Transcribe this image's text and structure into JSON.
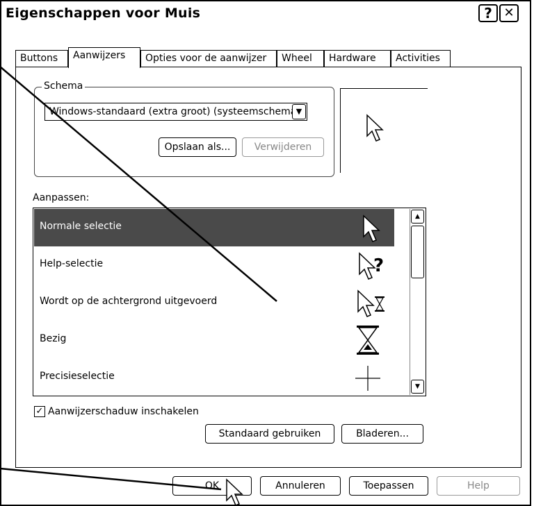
{
  "window": {
    "title": "Eigenschappen voor Muis",
    "help_glyph": "?",
    "close_glyph": "✕"
  },
  "tabs": [
    {
      "label": "Buttons"
    },
    {
      "label": "Aanwijzers"
    },
    {
      "label": "Opties voor de aanwijzer"
    },
    {
      "label": "Wheel"
    },
    {
      "label": "Hardware"
    },
    {
      "label": "Activities"
    }
  ],
  "active_tab": "Aanwijzers",
  "schema": {
    "group_label": "Schema",
    "selected": "Windows-standaard (extra groot) (systeemschema)",
    "save_as_label": "Opslaan als...",
    "delete_label": "Verwijderen"
  },
  "customize": {
    "label": "Aanpassen:",
    "items": [
      {
        "label": "Normale selectie",
        "icon": "arrow-pointer-icon",
        "selected": true
      },
      {
        "label": "Help-selectie",
        "icon": "help-pointer-icon",
        "selected": false
      },
      {
        "label": "Wordt op de achtergrond uitgevoerd",
        "icon": "working-in-background-icon",
        "selected": false
      },
      {
        "label": "Bezig",
        "icon": "hourglass-icon",
        "selected": false
      },
      {
        "label": "Precisieselectie",
        "icon": "crosshair-icon",
        "selected": false
      }
    ]
  },
  "shadow": {
    "label": "Aanwijzerschaduw inschakelen",
    "checked": true
  },
  "buttons": {
    "use_default": "Standaard gebruiken",
    "browse": "Bladeren...",
    "ok": "OK",
    "cancel": "Annuleren",
    "apply": "Toepassen",
    "help": "Help"
  }
}
